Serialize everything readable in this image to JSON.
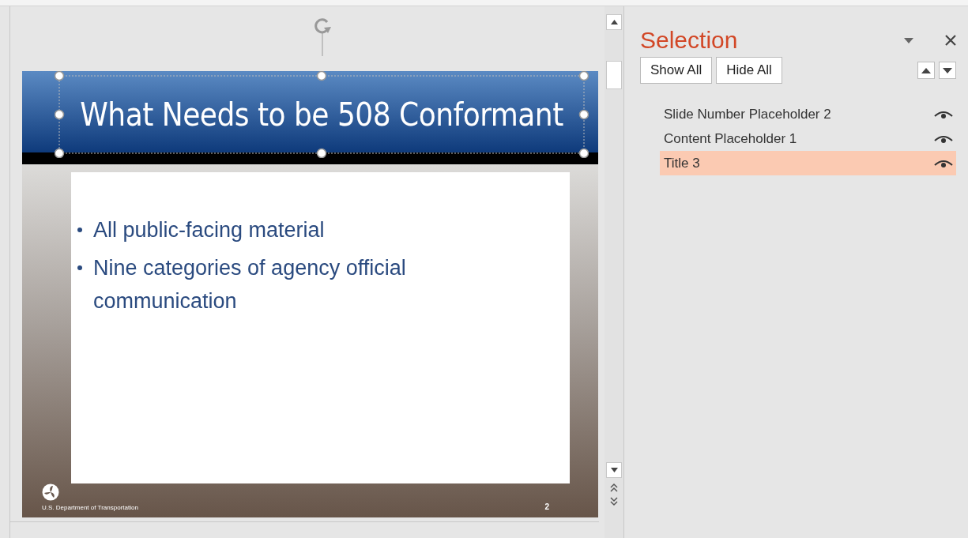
{
  "slide": {
    "title": "What Needs to be 508 Conformant",
    "bullets": [
      "All public-facing material",
      "Nine categories of agency official communication"
    ],
    "footer": "U.S. Department of Transportation",
    "slide_number": "2"
  },
  "selection_pane": {
    "title": "Selection",
    "buttons": [
      "Show All",
      "Hide All"
    ],
    "items": [
      {
        "label": "Slide Number Placeholder 2",
        "selected": false,
        "visible": true
      },
      {
        "label": "Content Placeholder 1",
        "selected": false,
        "visible": true
      },
      {
        "label": "Title 3",
        "selected": true,
        "visible": true
      }
    ]
  }
}
